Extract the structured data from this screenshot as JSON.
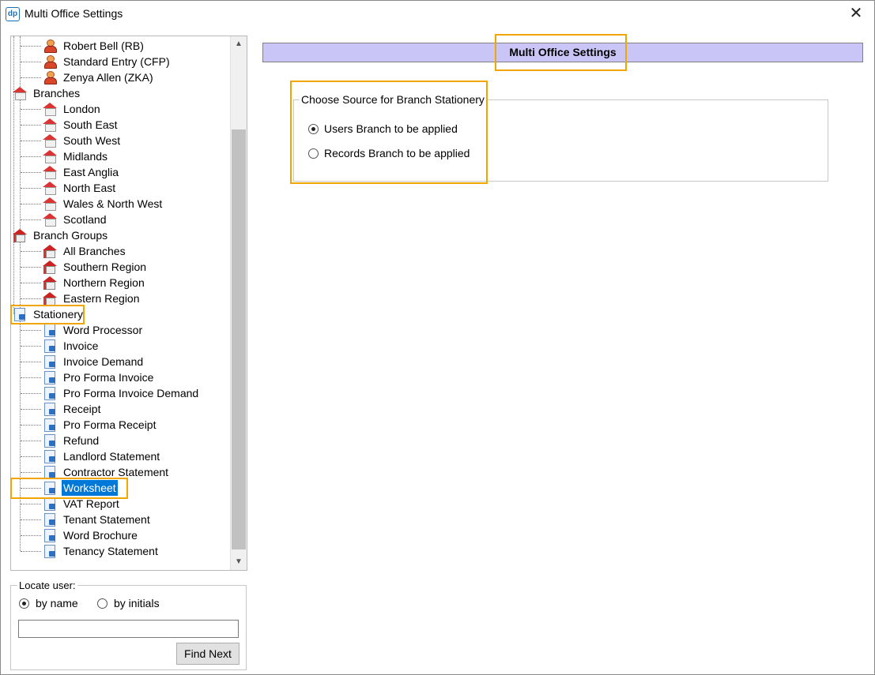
{
  "window": {
    "title": "Multi Office Settings"
  },
  "tree": {
    "items": [
      {
        "label": "Robert Bell  (RB)",
        "icon": "user-icon",
        "level": 2
      },
      {
        "label": "Standard Entry  (CFP)",
        "icon": "user-icon",
        "level": 2
      },
      {
        "label": "Zenya Allen  (ZKA)",
        "icon": "user-icon",
        "level": 2
      },
      {
        "label": "Branches",
        "icon": "branch-icon",
        "level": 1
      },
      {
        "label": "London",
        "icon": "branch-icon",
        "level": 2
      },
      {
        "label": "South East",
        "icon": "branch-icon",
        "level": 2
      },
      {
        "label": "South West",
        "icon": "branch-icon",
        "level": 2
      },
      {
        "label": "Midlands",
        "icon": "branch-icon",
        "level": 2
      },
      {
        "label": "East Anglia",
        "icon": "branch-icon",
        "level": 2
      },
      {
        "label": "North East",
        "icon": "branch-icon",
        "level": 2
      },
      {
        "label": "Wales & North West",
        "icon": "branch-icon",
        "level": 2
      },
      {
        "label": "Scotland",
        "icon": "branch-icon",
        "level": 2
      },
      {
        "label": "Branch Groups",
        "icon": "branch-group-icon",
        "level": 1
      },
      {
        "label": "All Branches",
        "icon": "branch-group-icon",
        "level": 2
      },
      {
        "label": "Southern Region",
        "icon": "branch-group-icon",
        "level": 2
      },
      {
        "label": "Northern Region",
        "icon": "branch-group-icon",
        "level": 2
      },
      {
        "label": "Eastern Region",
        "icon": "branch-group-icon",
        "level": 2
      },
      {
        "label": "Stationery",
        "icon": "stationery-icon",
        "level": 1
      },
      {
        "label": "Word Processor",
        "icon": "stationery-icon",
        "level": 2
      },
      {
        "label": "Invoice",
        "icon": "stationery-icon",
        "level": 2
      },
      {
        "label": "Invoice Demand",
        "icon": "stationery-icon",
        "level": 2
      },
      {
        "label": "Pro Forma Invoice",
        "icon": "stationery-icon",
        "level": 2
      },
      {
        "label": "Pro Forma Invoice Demand",
        "icon": "stationery-icon",
        "level": 2
      },
      {
        "label": "Receipt",
        "icon": "stationery-icon",
        "level": 2
      },
      {
        "label": "Pro Forma Receipt",
        "icon": "stationery-icon",
        "level": 2
      },
      {
        "label": "Refund",
        "icon": "stationery-icon",
        "level": 2
      },
      {
        "label": "Landlord Statement",
        "icon": "stationery-icon",
        "level": 2
      },
      {
        "label": "Contractor Statement",
        "icon": "stationery-icon",
        "level": 2
      },
      {
        "label": "Worksheet",
        "icon": "stationery-icon",
        "level": 2,
        "selected": true
      },
      {
        "label": "VAT Report",
        "icon": "stationery-icon",
        "level": 2
      },
      {
        "label": "Tenant Statement",
        "icon": "stationery-icon",
        "level": 2
      },
      {
        "label": "Word Brochure",
        "icon": "stationery-icon",
        "level": 2
      },
      {
        "label": "Tenancy Statement",
        "icon": "stationery-icon",
        "level": 2
      }
    ]
  },
  "locate": {
    "legend": "Locate user:",
    "by_name": "by name",
    "by_initials": "by initials",
    "selected": "by name",
    "search_value": "",
    "find_next": "Find Next"
  },
  "main": {
    "header": "Multi Office Settings",
    "group_title": "Choose Source for Branch Stationery",
    "option_users": "Users Branch to be applied",
    "option_records": "Records Branch to be applied",
    "selected_option": "Users Branch to be applied"
  },
  "colors": {
    "header_bg": "#c9c6f7",
    "highlight": "#f0a500",
    "selection": "#0078d7"
  }
}
